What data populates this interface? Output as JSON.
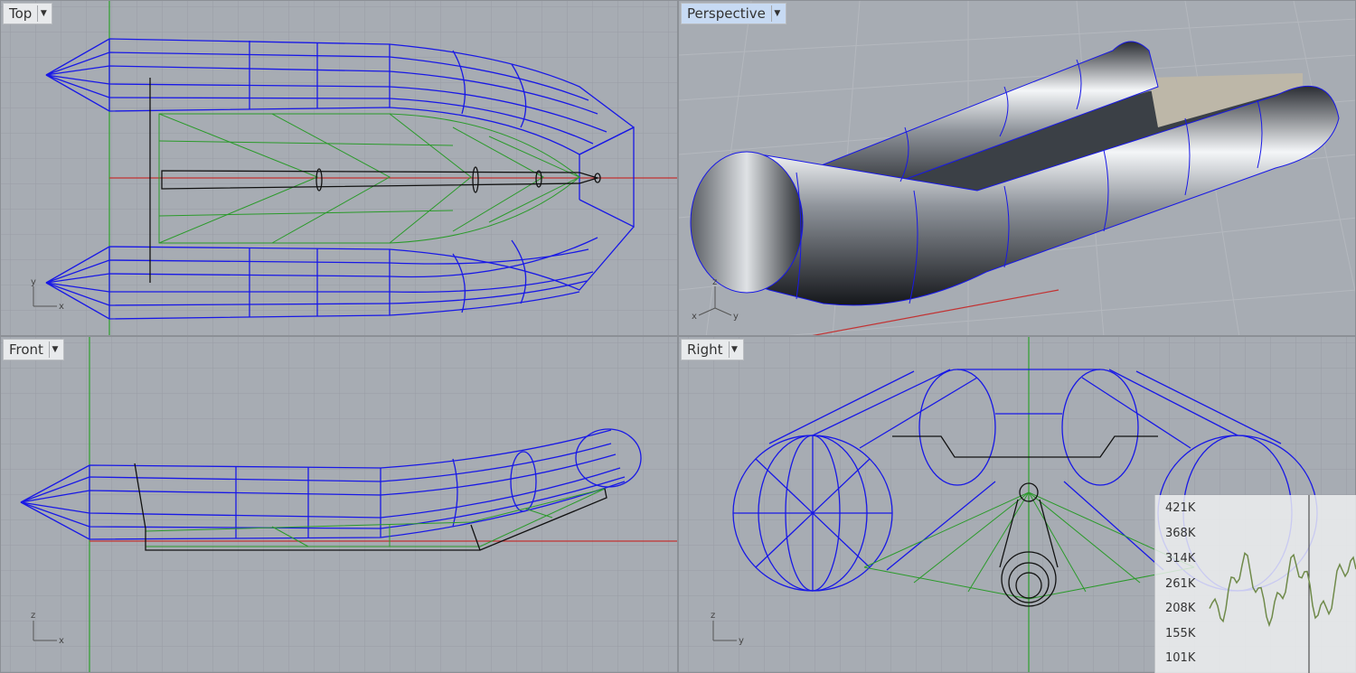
{
  "viewports": {
    "top": {
      "label": "Top"
    },
    "perspective": {
      "label": "Perspective"
    },
    "front": {
      "label": "Front"
    },
    "right": {
      "label": "Right"
    }
  },
  "axes": {
    "x": "x",
    "y": "y",
    "z": "z"
  },
  "perf_widget": {
    "y_labels": [
      "421K",
      "368K",
      "314K",
      "261K",
      "208K",
      "155K",
      "101K"
    ],
    "line_color": "#6f8a4a"
  },
  "colors": {
    "viewport_bg": "#a7acb3",
    "grid": "#989da4",
    "wire_blue": "#1818e6",
    "wire_green": "#2a9a2a",
    "axis_x": "#c23232",
    "axis_y": "#2ea02e",
    "active_tab": "#c7daf3"
  }
}
